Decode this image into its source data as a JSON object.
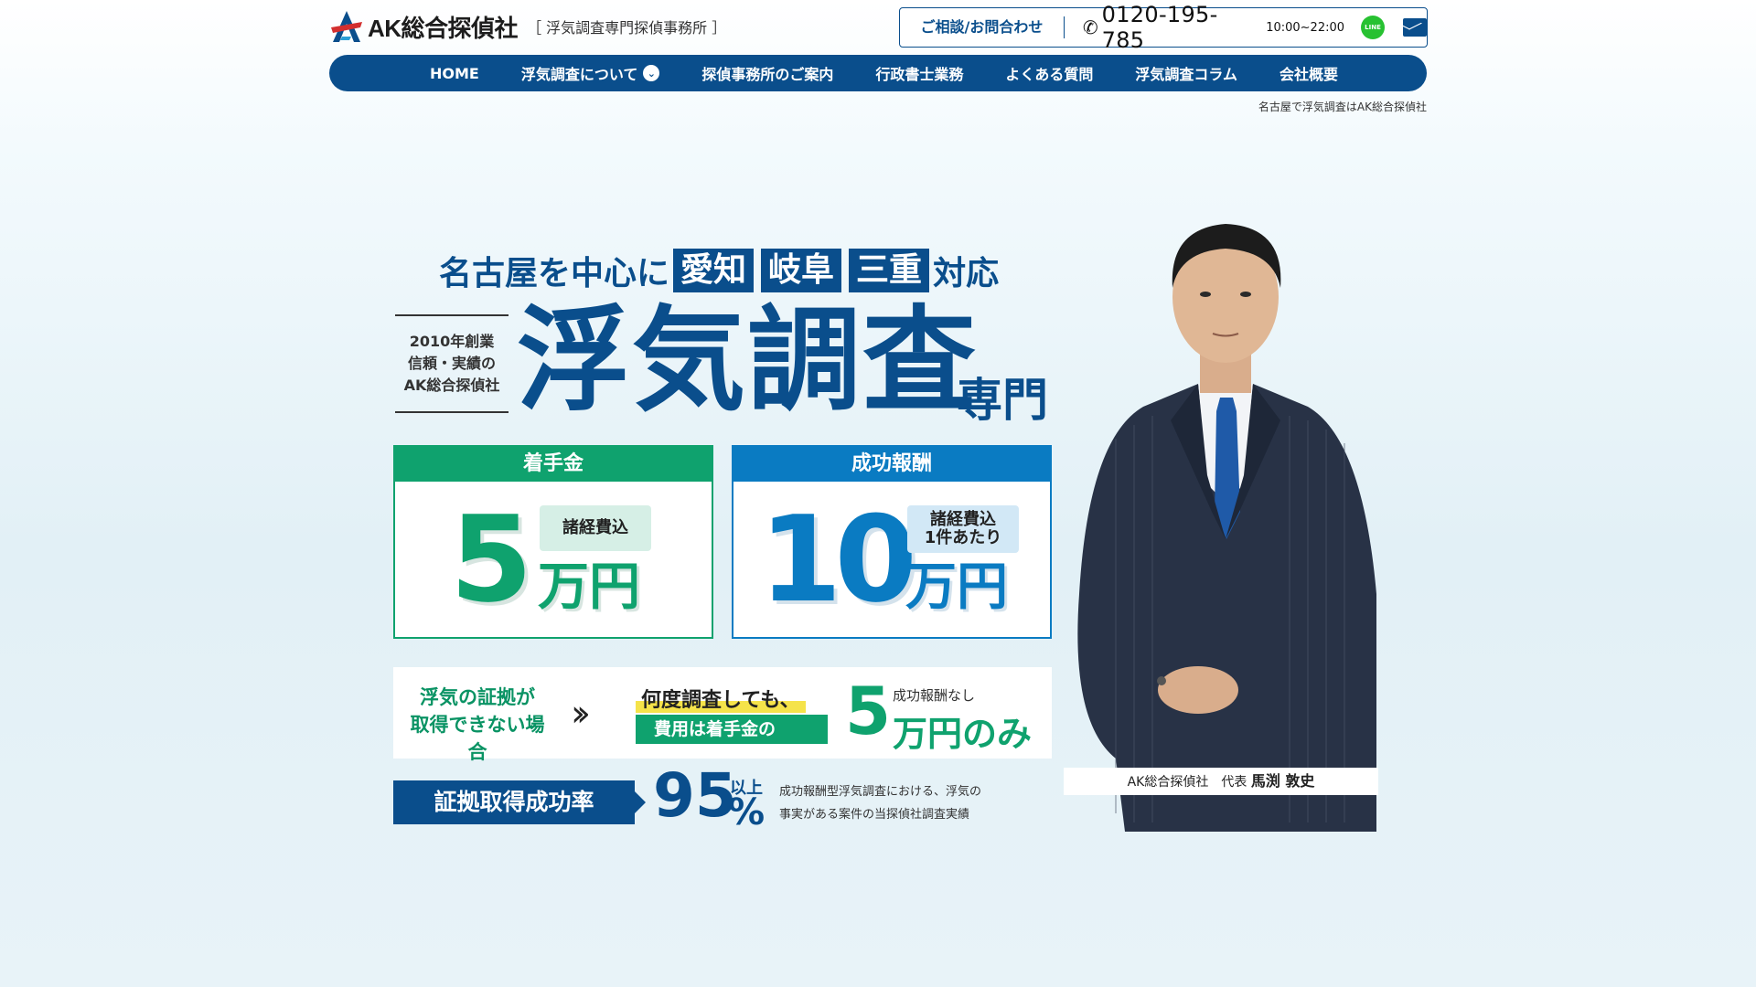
{
  "header": {
    "logo_text": "AK総合探偵社",
    "logo_sub": "［ 浮気調査専門探偵事務所 ］",
    "contact_label": "ご相談/お問合わせ",
    "phone": "0120-195-785",
    "hours": "10:00~22:00",
    "line_label": "LINE",
    "tagline": "名古屋で浮気調査はAK総合探偵社"
  },
  "nav": {
    "items": [
      {
        "label": "HOME"
      },
      {
        "label": "浮気調査について"
      },
      {
        "label": "探偵事務所のご案内"
      },
      {
        "label": "行政書士業務"
      },
      {
        "label": "よくある質問"
      },
      {
        "label": "浮気調査コラム"
      },
      {
        "label": "会社概要"
      }
    ]
  },
  "hero": {
    "area_prefix": "名古屋を中心に",
    "areas": [
      "愛知",
      "岐阜",
      "三重"
    ],
    "area_suffix": "対応",
    "est_lines": [
      "2010年創業",
      "信頼・実績の",
      "AK総合探偵社"
    ],
    "title": "浮気調査",
    "title_sub": "専門",
    "card1": {
      "head": "着手金",
      "number": "5",
      "badge": "諸経費込",
      "unit": "万円",
      "color": "#0fa26e"
    },
    "card2": {
      "head": "成功報酬",
      "number": "10",
      "badge_1": "諸経費込",
      "badge_2": "1件あたり",
      "unit": "万円",
      "color": "#0a7bc2"
    },
    "band": {
      "left_1": "浮気の証拠が",
      "left_2": "取得できない場合",
      "mid_1": "何度調査しても、",
      "mid_2": "費用は着手金の",
      "five": "5",
      "small": "成功報酬なし",
      "man": "万円のみ"
    },
    "rate": {
      "label": "証拠取得成功率",
      "number": "95",
      "up": "以上",
      "pct": "%",
      "note_1": "成功報酬型浮気調査における、浮気の",
      "note_2": "事実がある案件の当探偵社調査実績"
    },
    "caption_company": "AK総合探偵社　代表",
    "caption_name": "馬渕 敦史"
  },
  "colors": {
    "brand": "#0a4e8c",
    "green": "#0fa26e",
    "blue": "#0a7bc2",
    "line": "#27c131"
  }
}
